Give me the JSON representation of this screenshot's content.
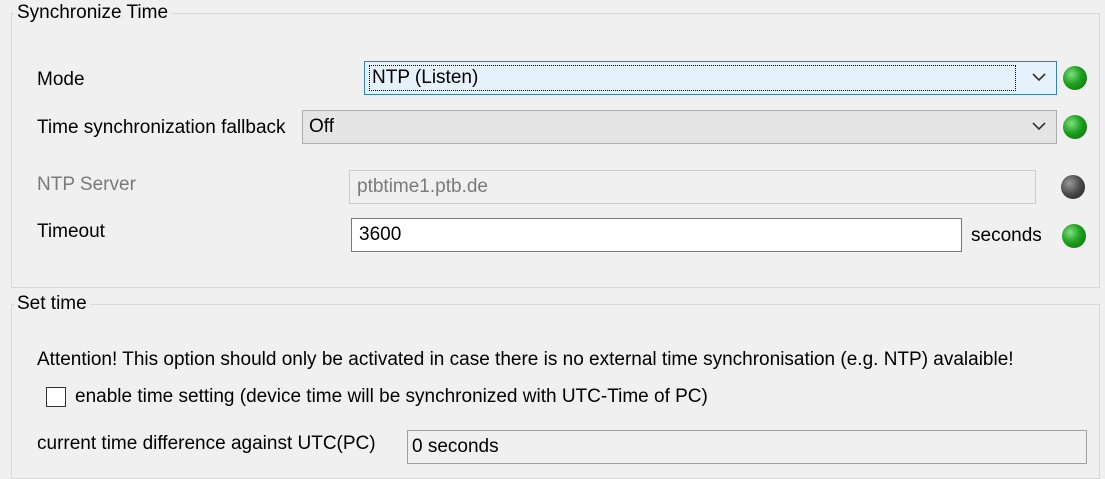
{
  "sync_group": {
    "title": "Synchronize Time",
    "mode": {
      "label": "Mode",
      "value": "NTP (Listen)",
      "status": "green"
    },
    "fallback": {
      "label": "Time synchronization fallback",
      "value": "Off",
      "status": "green"
    },
    "ntp_server": {
      "label": "NTP Server",
      "value": "ptbtime1.ptb.de",
      "status": "gray"
    },
    "timeout": {
      "label": "Timeout",
      "value": "3600",
      "unit": "seconds",
      "status": "green"
    }
  },
  "set_time_group": {
    "title": "Set time",
    "attention": "Attention! This option should only be activated in case there is no external time synchronisation (e.g. NTP) avalaible!",
    "enable_label": "enable time setting (device time will be synchronized with UTC-Time of PC)",
    "enable_checked": false,
    "diff_label": "current time difference against UTC(PC)",
    "diff_value": "0 seconds"
  },
  "colors": {
    "led_green": "#1fa01f",
    "led_gray": "#4a4a4a",
    "focus_border": "#3c7fb1"
  },
  "icons": {
    "dropdown": "chevron-down-icon",
    "status": "status-led-icon"
  }
}
